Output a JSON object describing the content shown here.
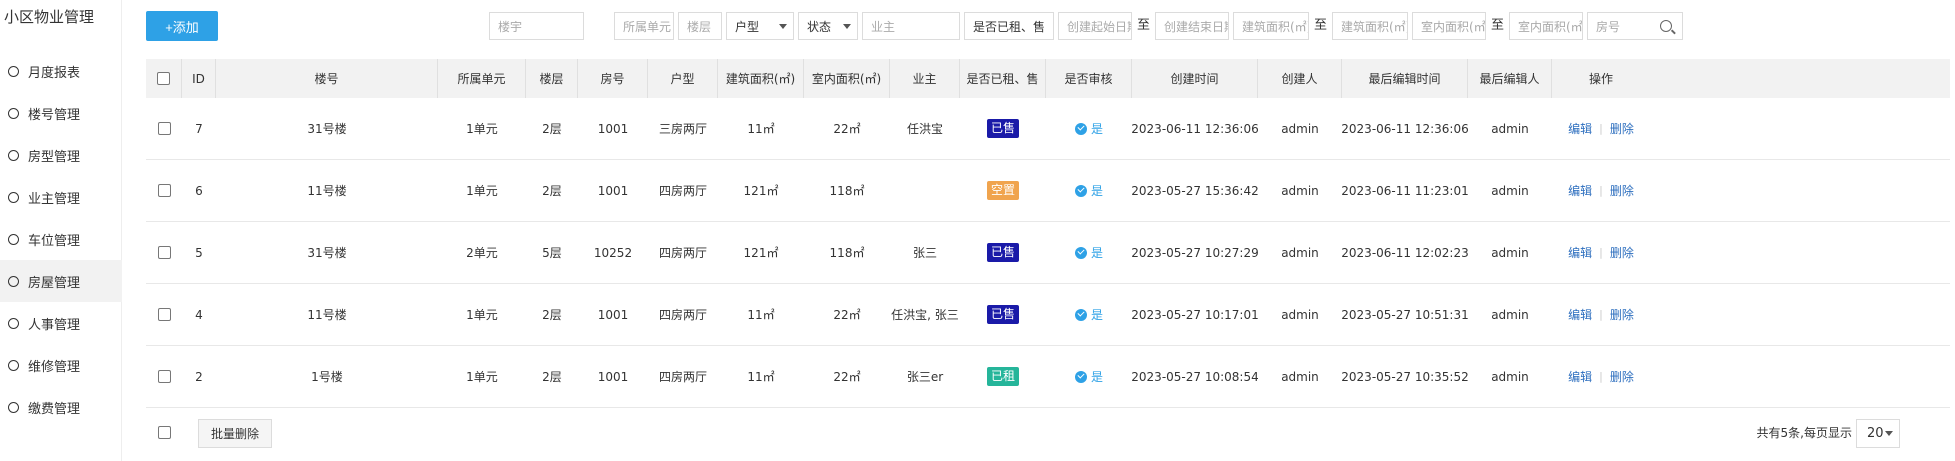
{
  "app": {
    "brand": "小区物业管理"
  },
  "sidebar": {
    "items": [
      {
        "label": "月度报表",
        "active": false
      },
      {
        "label": "楼号管理",
        "active": false
      },
      {
        "label": "房型管理",
        "active": false
      },
      {
        "label": "业主管理",
        "active": false
      },
      {
        "label": "车位管理",
        "active": false
      },
      {
        "label": "房屋管理",
        "active": true
      },
      {
        "label": "人事管理",
        "active": false
      },
      {
        "label": "维修管理",
        "active": false
      },
      {
        "label": "缴费管理",
        "active": false
      }
    ]
  },
  "toolbar": {
    "add_label": "+添加"
  },
  "filters": {
    "building": "楼宇",
    "unit": "所属单元",
    "floor": "楼层",
    "house_type": "户型",
    "status": "状态",
    "owner": "业主",
    "rent_sale": "是否已租、售",
    "create_start": "创建起始日期",
    "to1": "至",
    "create_end": "创建结束日期",
    "build_area_min": "建筑面积(㎡)",
    "to2": "至",
    "build_area_max": "建筑面积(㎡)",
    "inner_area_min": "室内面积(㎡)",
    "to3": "至",
    "inner_area_max": "室内面积(㎡)",
    "room_no": "房号"
  },
  "table": {
    "headers": [
      "ID",
      "楼号",
      "所属单元",
      "楼层",
      "房号",
      "户型",
      "建筑面积(㎡)",
      "室内面积(㎡)",
      "业主",
      "是否已租、售",
      "是否审核",
      "创建时间",
      "创建人",
      "最后编辑时间",
      "最后编辑人",
      "操作"
    ],
    "rows": [
      {
        "id": "7",
        "building": "31号楼",
        "unit": "1单元",
        "floor": "2层",
        "room": "1001",
        "type": "三房两厅",
        "build_area": "11㎡",
        "inner_area": "22㎡",
        "owner": "任洪宝",
        "status": "已售",
        "audit": "是",
        "created": "2023-06-11 12:36:06",
        "creator": "admin",
        "edited": "2023-06-11 12:36:06",
        "editor": "admin",
        "edit": "编辑",
        "sep": "|",
        "delete": "删除"
      },
      {
        "id": "6",
        "building": "11号楼",
        "unit": "1单元",
        "floor": "2层",
        "room": "1001",
        "type": "四房两厅",
        "build_area": "121㎡",
        "inner_area": "118㎡",
        "owner": "",
        "status": "空置",
        "audit": "是",
        "created": "2023-05-27 15:36:42",
        "creator": "admin",
        "edited": "2023-06-11 11:23:01",
        "editor": "admin",
        "edit": "编辑",
        "sep": "|",
        "delete": "删除"
      },
      {
        "id": "5",
        "building": "31号楼",
        "unit": "2单元",
        "floor": "5层",
        "room": "10252",
        "type": "四房两厅",
        "build_area": "121㎡",
        "inner_area": "118㎡",
        "owner": "张三",
        "status": "已售",
        "audit": "是",
        "created": "2023-05-27 10:27:29",
        "creator": "admin",
        "edited": "2023-06-11 12:02:23",
        "editor": "admin",
        "edit": "编辑",
        "sep": "|",
        "delete": "删除"
      },
      {
        "id": "4",
        "building": "11号楼",
        "unit": "1单元",
        "floor": "2层",
        "room": "1001",
        "type": "四房两厅",
        "build_area": "11㎡",
        "inner_area": "22㎡",
        "owner": "任洪宝, 张三",
        "status": "已售",
        "audit": "是",
        "created": "2023-05-27 10:17:01",
        "creator": "admin",
        "edited": "2023-05-27 10:51:31",
        "editor": "admin",
        "edit": "编辑",
        "sep": "|",
        "delete": "删除"
      },
      {
        "id": "2",
        "building": "1号楼",
        "unit": "1单元",
        "floor": "2层",
        "room": "1001",
        "type": "四房两厅",
        "build_area": "11㎡",
        "inner_area": "22㎡",
        "owner": "张三er",
        "status": "已租",
        "audit": "是",
        "created": "2023-05-27 10:08:54",
        "creator": "admin",
        "edited": "2023-05-27 10:35:52",
        "editor": "admin",
        "edit": "编辑",
        "sep": "|",
        "delete": "删除"
      }
    ]
  },
  "status_colors": {
    "已售": "#1a1aa8",
    "空置": "#f0a44e",
    "已租": "#25b59a"
  },
  "footer": {
    "batch_delete": "批量删除",
    "total": "共有5条,每页显示",
    "page_size": "20"
  }
}
